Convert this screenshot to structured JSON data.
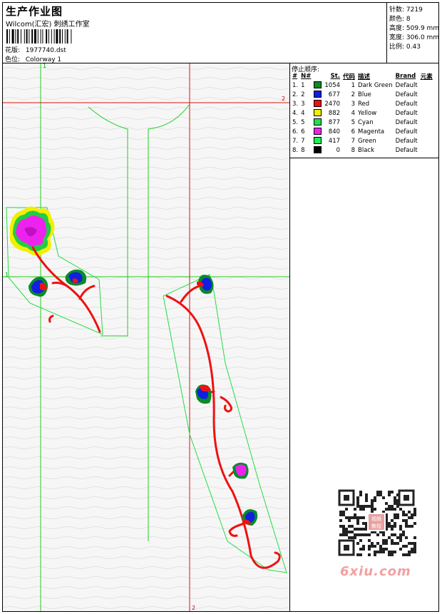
{
  "header": {
    "title": "生产作业图",
    "company": "Wilcom(汇宏) 刺绣工作室",
    "design_label": "花版:",
    "design_value": "1977740.dst",
    "colorway_label": "色位:",
    "colorway_value": "Colorway 1"
  },
  "info": {
    "stitches_label": "针数:",
    "stitches_value": "7219",
    "colors_label": "颜色:",
    "colors_value": "8",
    "height_label": "高度:",
    "height_value": "509.9 mm",
    "width_label": "宽度:",
    "width_value": "306.0 mm",
    "scale_label": "比例:",
    "scale_value": "0.43"
  },
  "legend": {
    "title": "停止顺序:",
    "columns": [
      "#",
      "N#",
      "",
      "St.",
      "代码",
      "描述",
      "Brand",
      "元素"
    ],
    "rows": [
      {
        "idx": "1.",
        "n": "1",
        "color": "#0a8a2a",
        "st": "1054",
        "code": "1",
        "desc": "Dark Green",
        "brand": "Default"
      },
      {
        "idx": "2.",
        "n": "2",
        "color": "#1020e0",
        "st": "677",
        "code": "2",
        "desc": "Blue",
        "brand": "Default"
      },
      {
        "idx": "3.",
        "n": "3",
        "color": "#ee1111",
        "st": "2470",
        "code": "3",
        "desc": "Red",
        "brand": "Default"
      },
      {
        "idx": "4.",
        "n": "4",
        "color": "#f0f000",
        "st": "882",
        "code": "4",
        "desc": "Yellow",
        "brand": "Default"
      },
      {
        "idx": "5.",
        "n": "5",
        "color": "#22dd55",
        "st": "877",
        "code": "5",
        "desc": "Cyan",
        "brand": "Default"
      },
      {
        "idx": "6.",
        "n": "6",
        "color": "#ee22ee",
        "st": "840",
        "code": "6",
        "desc": "Magenta",
        "brand": "Default"
      },
      {
        "idx": "7.",
        "n": "7",
        "color": "#22ee55",
        "st": "417",
        "code": "7",
        "desc": "Green",
        "brand": "Default"
      },
      {
        "idx": "8.",
        "n": "8",
        "color": "#000000",
        "st": "0",
        "code": "8",
        "desc": "Black",
        "brand": "Default"
      }
    ]
  },
  "canvas": {
    "axis_green_top": "1",
    "axis_green_left": "1",
    "axis_red_right": "2",
    "axis_red_bottom": "2"
  },
  "watermark": "6xiu.com",
  "qr_badge": "视频 教程"
}
